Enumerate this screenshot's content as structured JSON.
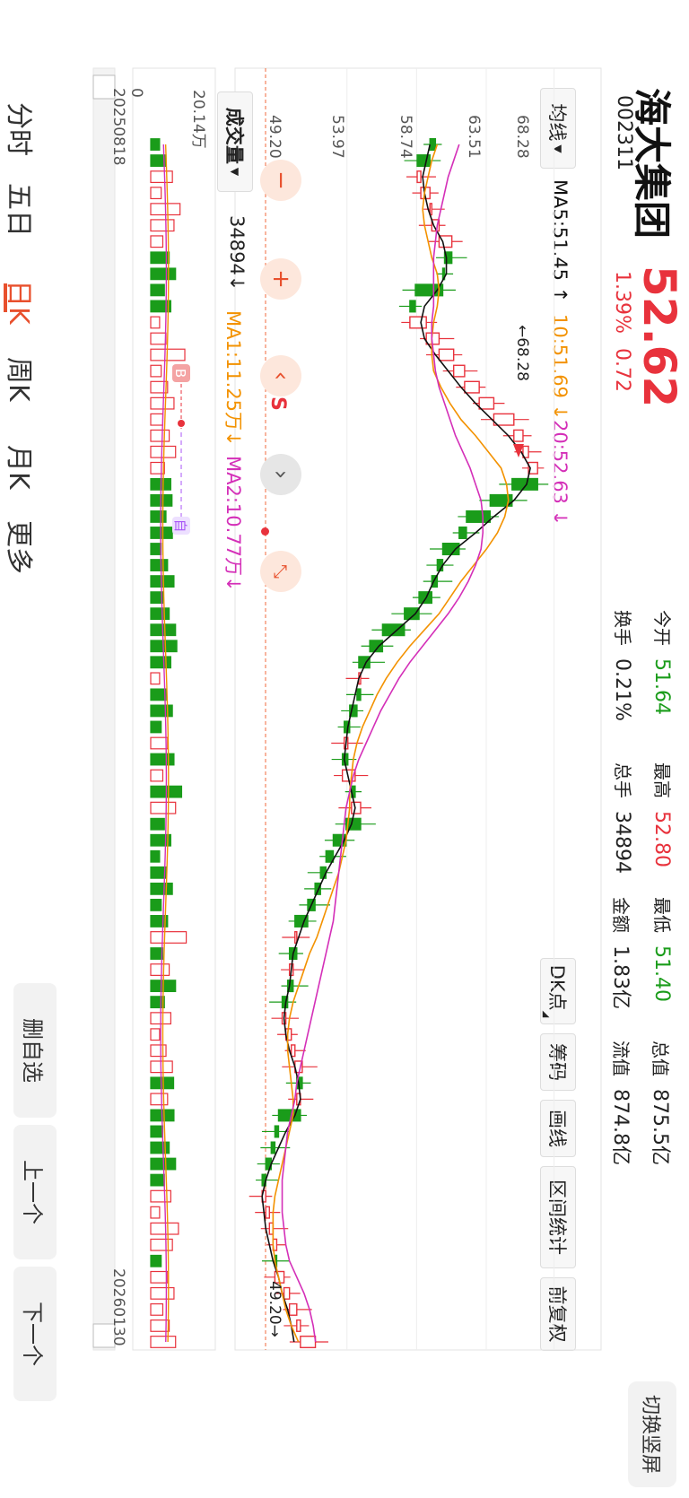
{
  "header": {
    "name": "海大集团",
    "code": "002311",
    "price": "52.62",
    "change_pct": "1.39%",
    "change": "0.72",
    "switch_label": "切换竖屏"
  },
  "stats": [
    {
      "label": "今开",
      "value": "51.64",
      "color": "#1a9c1a"
    },
    {
      "label": "最高",
      "value": "52.80",
      "color": "#e8323c"
    },
    {
      "label": "最低",
      "value": "51.40",
      "color": "#1a9c1a"
    },
    {
      "label": "总值",
      "value": "875.5亿",
      "color": "#222222"
    },
    {
      "label": "换手",
      "value": "0.21%",
      "color": "#222222"
    },
    {
      "label": "总手",
      "value": "34894",
      "color": "#222222"
    },
    {
      "label": "金额",
      "value": "1.83亿",
      "color": "#222222"
    },
    {
      "label": "流值",
      "value": "874.8亿",
      "color": "#222222"
    }
  ],
  "toolbar": {
    "ma_select": "均线",
    "ma5": "MA5:51.45 ↑",
    "ma10": "10:51.69 ↓",
    "ma20": "20:52.63 ↓",
    "dk": "DK点",
    "chips": "筹码",
    "draw": "画线",
    "range_stat": "区间统计",
    "adjust": "前复权"
  },
  "volume_bar": {
    "select": "成交量",
    "vol": "34894↓",
    "ma1": "MA1:11.25万↓",
    "ma2": "MA2:10.77万↓"
  },
  "axes": {
    "price_ticks": [
      "68.28",
      "63.51",
      "58.74",
      "53.97",
      "49.20"
    ],
    "vol_top": "20.14万",
    "vol_zero": "0",
    "date_start": "20250818",
    "date_end": "20260130",
    "max_marker": "←68.28",
    "min_marker": "49.20→"
  },
  "markers": {
    "self": "自",
    "buy": "B",
    "sell": "S",
    "s_letter": "S"
  },
  "tabs": [
    "分时",
    "五日",
    "日K",
    "周K",
    "月K",
    "更多"
  ],
  "active_tab": 2,
  "side_buttons": [
    "删自选",
    "上一个",
    "下一个"
  ],
  "colors": {
    "up": "#e8323c",
    "down": "#1a9c1a",
    "ma5": "#111111",
    "ma10": "#f39200",
    "ma20": "#d42fb8"
  },
  "chart_data": {
    "type": "candlestick",
    "x": [
      "20250818",
      "20260130"
    ],
    "series": [
      {
        "name": "MA5",
        "values": [
          58.9,
          58.7,
          58.5,
          58.6,
          58.8,
          59.1,
          59.6,
          59.8,
          59.8,
          59.3,
          58.6,
          58.4,
          58.6,
          59.2,
          59.9,
          60.6,
          61.4,
          62.3,
          63.2,
          63.9,
          64.4,
          64.2,
          63.5,
          62.4,
          61.4,
          60.3,
          59.6,
          59.1,
          58.7,
          58.1,
          57.1,
          56.1,
          55.4,
          55.0,
          54.8,
          54.6,
          54.4,
          54.3,
          54.2,
          54.4,
          54.6,
          54.8,
          54.6,
          54.2,
          53.7,
          53.2,
          52.8,
          52.4,
          52.0,
          51.7,
          51.4,
          51.3,
          51.2,
          51.0,
          50.9,
          51.0,
          51.2,
          51.5,
          51.7,
          51.8,
          51.5,
          51.0,
          50.6,
          50.2,
          49.9,
          49.7,
          49.8,
          49.9,
          50.1,
          50.3,
          50.6,
          50.8,
          51.1,
          51.3,
          51.45
        ]
      },
      {
        "name": "MA10",
        "values": [
          59.3,
          59.0,
          58.8,
          58.6,
          58.5,
          58.6,
          58.8,
          59.0,
          59.3,
          59.4,
          59.3,
          59.1,
          59.0,
          59.0,
          59.1,
          59.5,
          60.0,
          60.6,
          61.4,
          62.1,
          62.8,
          63.1,
          63.2,
          63.0,
          62.6,
          62.0,
          61.3,
          60.6,
          60.0,
          59.4,
          58.6,
          57.8,
          57.1,
          56.5,
          56.0,
          55.6,
          55.2,
          54.9,
          54.7,
          54.6,
          54.5,
          54.5,
          54.4,
          54.3,
          54.1,
          53.9,
          53.6,
          53.3,
          53.0,
          52.7,
          52.3,
          52.0,
          51.7,
          51.4,
          51.2,
          51.1,
          51.1,
          51.2,
          51.3,
          51.4,
          51.4,
          51.2,
          51.0,
          50.8,
          50.6,
          50.4,
          50.3,
          50.3,
          50.3,
          50.4,
          50.6,
          50.8,
          51.0,
          51.3,
          51.69
        ]
      },
      {
        "name": "MA20",
        "values": [
          60.5,
          60.2,
          59.9,
          59.7,
          59.5,
          59.3,
          59.2,
          59.1,
          59.1,
          59.1,
          59.1,
          59.0,
          59.0,
          59.1,
          59.2,
          59.4,
          59.7,
          60.0,
          60.3,
          60.7,
          61.1,
          61.4,
          61.7,
          61.8,
          61.8,
          61.7,
          61.4,
          61.0,
          60.5,
          59.9,
          59.2,
          58.5,
          57.8,
          57.2,
          56.7,
          56.2,
          55.8,
          55.4,
          55.0,
          54.7,
          54.5,
          54.3,
          54.2,
          54.1,
          54.0,
          53.9,
          53.8,
          53.7,
          53.6,
          53.4,
          53.2,
          53.0,
          52.8,
          52.6,
          52.4,
          52.2,
          52.0,
          51.8,
          51.6,
          51.5,
          51.3,
          51.1,
          51.0,
          50.9,
          50.8,
          50.8,
          50.8,
          50.9,
          51.0,
          51.2,
          51.6,
          52.0,
          52.3,
          52.5,
          52.63
        ]
      }
    ],
    "close": [
      58.9,
      58.2,
      58.4,
      58.9,
      59.0,
      59.4,
      60.1,
      59.7,
      59.6,
      58.1,
      57.8,
      58.7,
      59.4,
      60.2,
      60.8,
      61.6,
      62.4,
      63.5,
      64.0,
      64.3,
      64.8,
      63.4,
      62.2,
      60.9,
      60.5,
      59.6,
      59.3,
      59.0,
      58.3,
      57.5,
      56.3,
      55.6,
      55.0,
      55.1,
      54.9,
      54.5,
      54.2,
      54.4,
      54.1,
      54.8,
      54.6,
      55.1,
      54.3,
      53.6,
      53.2,
      52.9,
      52.6,
      52.2,
      51.5,
      51.6,
      51.2,
      51.4,
      51.1,
      50.8,
      51.0,
      51.3,
      51.5,
      51.9,
      51.6,
      51.8,
      50.6,
      50.4,
      50.2,
      49.9,
      49.7,
      49.9,
      50.1,
      50.3,
      50.5,
      50.4,
      50.9,
      51.2,
      51.6,
      51.8,
      52.62
    ],
    "ylim": [
      49.2,
      68.28
    ],
    "volume": {
      "ylim": [
        0,
        201400
      ],
      "ma1": 112500,
      "ma2": 107700,
      "last": 34894
    }
  }
}
